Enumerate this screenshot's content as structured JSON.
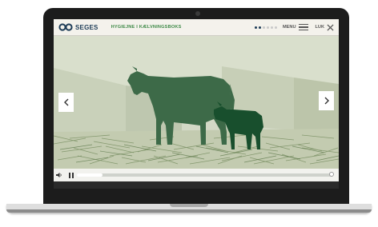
{
  "app": {
    "logo_text": "SEGES",
    "title": "HYGIEJNE I KÆLVNINGSBOKS"
  },
  "header": {
    "menu_label": "MENU",
    "close_label": "LUK",
    "progress_dots": {
      "total": 6,
      "current": 2
    }
  },
  "icons": {
    "logo": "seges-logo-icon",
    "menu": "hamburger-icon",
    "close": "close-icon",
    "prev": "chevron-left-icon",
    "next": "chevron-right-icon",
    "volume": "volume-icon",
    "pause": "pause-icon"
  },
  "player": {
    "progress": 0.1
  },
  "colors": {
    "brand_navy": "#1d3c57",
    "brand_green": "#3f8a48",
    "cow": "#3d6a48",
    "calf": "#184f2d",
    "background_scene": "#d3d9c6"
  }
}
